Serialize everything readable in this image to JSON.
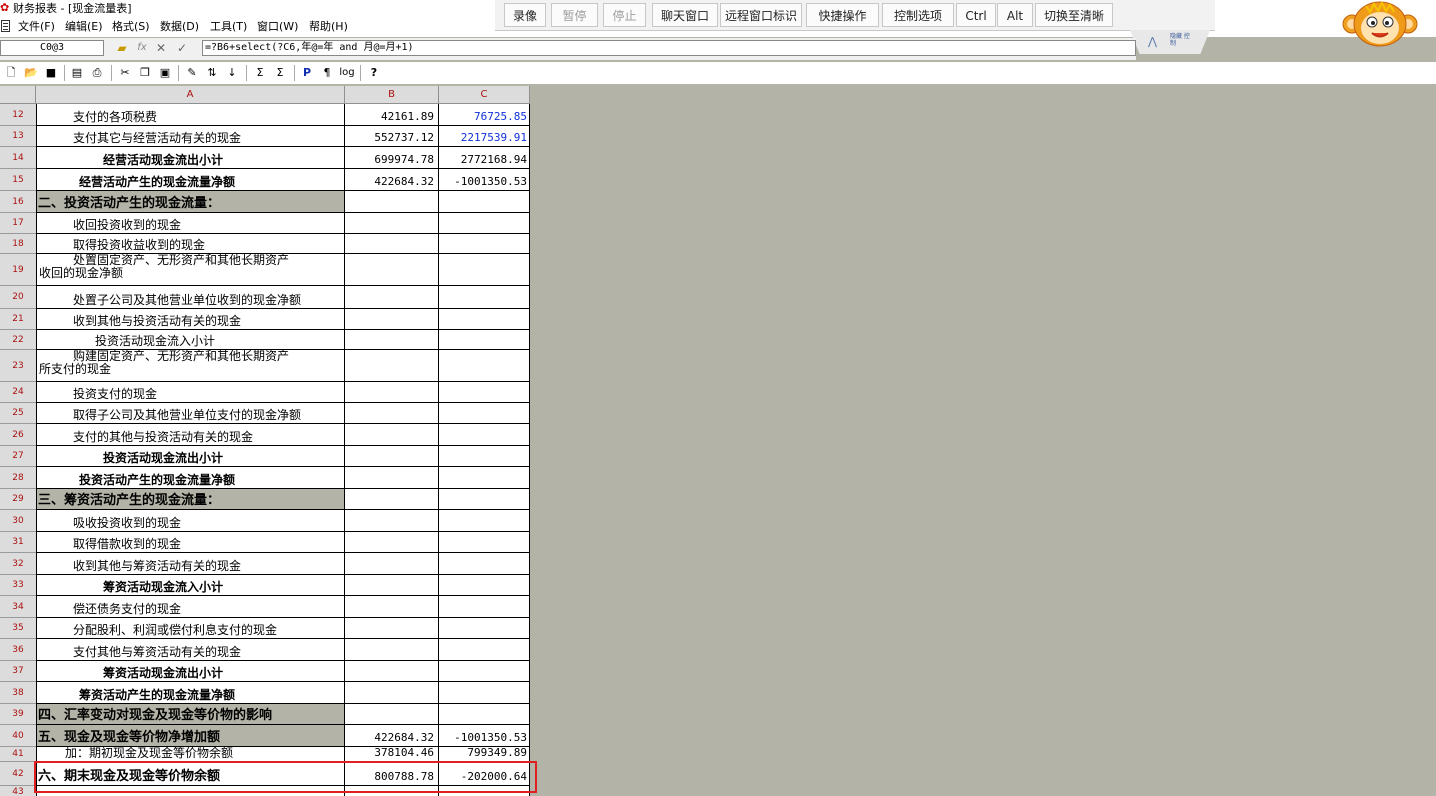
{
  "window": {
    "title": "财务报表 - [现金流量表]"
  },
  "menu": [
    "文件(F)",
    "编辑(E)",
    "格式(S)",
    "数据(D)",
    "工具(T)",
    "窗口(W)",
    "帮助(H)"
  ],
  "remote_toolbar": {
    "buttons": [
      {
        "label": "录像",
        "enabled": true
      },
      {
        "label": "暂停",
        "enabled": false
      },
      {
        "label": "停止",
        "enabled": false
      },
      {
        "label": "聊天窗口",
        "enabled": true
      },
      {
        "label": "远程窗口标识",
        "enabled": true
      },
      {
        "label": "快捷操作",
        "enabled": true
      },
      {
        "label": "控制选项",
        "enabled": true
      },
      {
        "label": "Ctrl",
        "enabled": true
      },
      {
        "label": "Alt",
        "enabled": true
      },
      {
        "label": "切换至清晰",
        "enabled": true
      }
    ],
    "tab_label": "隐藏 控制"
  },
  "formula_bar": {
    "cell_ref": "C0@3",
    "formula": "=?B6+select(?C6,年@=年 and 月@=月+1)"
  },
  "columns": [
    "A",
    "B",
    "C"
  ],
  "rows": [
    {
      "num": "12",
      "a": "支付的各项税费",
      "b": "42161.89",
      "c": "76725.85",
      "c_blue": true
    },
    {
      "num": "13",
      "a": "支付其它与经营活动有关的现金",
      "b": "552737.12",
      "c": "2217539.91",
      "c_blue": true
    },
    {
      "num": "14",
      "a": "经营活动现金流出小计",
      "b": "699974.78",
      "c": "2772168.94",
      "bold": true
    },
    {
      "num": "15",
      "a": "经营活动产生的现金流量净额",
      "b": "422684.32",
      "c": "-1001350.53",
      "bold": true
    },
    {
      "num": "16",
      "a": "二、投资活动产生的现金流量：",
      "b": "",
      "c": "",
      "section": true
    },
    {
      "num": "17",
      "a": "收回投资收到的现金",
      "b": "",
      "c": ""
    },
    {
      "num": "18",
      "a": "取得投资收益收到的现金",
      "b": "",
      "c": ""
    },
    {
      "num": "19",
      "a": "处置固定资产、无形资产和其他长期资产",
      "a2": "收回的现金净额",
      "b": "",
      "c": ""
    },
    {
      "num": "20",
      "a": "处置子公司及其他营业单位收到的现金净额",
      "b": "",
      "c": ""
    },
    {
      "num": "21",
      "a": "收到其他与投资活动有关的现金",
      "b": "",
      "c": ""
    },
    {
      "num": "22",
      "a": "投资活动现金流入小计",
      "b": "",
      "c": ""
    },
    {
      "num": "23",
      "a": "购建固定资产、无形资产和其他长期资产",
      "a2": "所支付的现金",
      "b": "",
      "c": ""
    },
    {
      "num": "24",
      "a": "投资支付的现金",
      "b": "",
      "c": ""
    },
    {
      "num": "25",
      "a": "取得子公司及其他营业单位支付的现金净额",
      "b": "",
      "c": ""
    },
    {
      "num": "26",
      "a": "支付的其他与投资活动有关的现金",
      "b": "",
      "c": ""
    },
    {
      "num": "27",
      "a": "投资活动现金流出小计",
      "b": "",
      "c": "",
      "bold": true
    },
    {
      "num": "28",
      "a": "投资活动产生的现金流量净额",
      "b": "",
      "c": "",
      "bold": true
    },
    {
      "num": "29",
      "a": "三、筹资活动产生的现金流量：",
      "b": "",
      "c": "",
      "section": true
    },
    {
      "num": "30",
      "a": "吸收投资收到的现金",
      "b": "",
      "c": ""
    },
    {
      "num": "31",
      "a": "取得借款收到的现金",
      "b": "",
      "c": ""
    },
    {
      "num": "32",
      "a": "收到其他与筹资活动有关的现金",
      "b": "",
      "c": ""
    },
    {
      "num": "33",
      "a": "筹资活动现金流入小计",
      "b": "",
      "c": "",
      "bold": true
    },
    {
      "num": "34",
      "a": "偿还债务支付的现金",
      "b": "",
      "c": ""
    },
    {
      "num": "35",
      "a": "分配股利、利润或偿付利息支付的现金",
      "b": "",
      "c": ""
    },
    {
      "num": "36",
      "a": "支付其他与筹资活动有关的现金",
      "b": "",
      "c": ""
    },
    {
      "num": "37",
      "a": "筹资活动现金流出小计",
      "b": "",
      "c": "",
      "bold": true
    },
    {
      "num": "38",
      "a": "筹资活动产生的现金流量净额",
      "b": "",
      "c": "",
      "bold": true
    },
    {
      "num": "39",
      "a": "四、汇率变动对现金及现金等价物的影响",
      "b": "",
      "c": "",
      "section": true
    },
    {
      "num": "40",
      "a": "五、现金及现金等价物净增加额",
      "b": "422684.32",
      "c": "-1001350.53",
      "section": true
    },
    {
      "num": "41",
      "a": "加：期初现金及现金等价物余额",
      "b": "378104.46",
      "c": "799349.89"
    },
    {
      "num": "42",
      "a": "六、期末现金及现金等价物余额",
      "b": "800788.78",
      "c": "-202000.64",
      "section": true,
      "white": true
    },
    {
      "num": "43",
      "a": "",
      "b": "",
      "c": ""
    }
  ]
}
